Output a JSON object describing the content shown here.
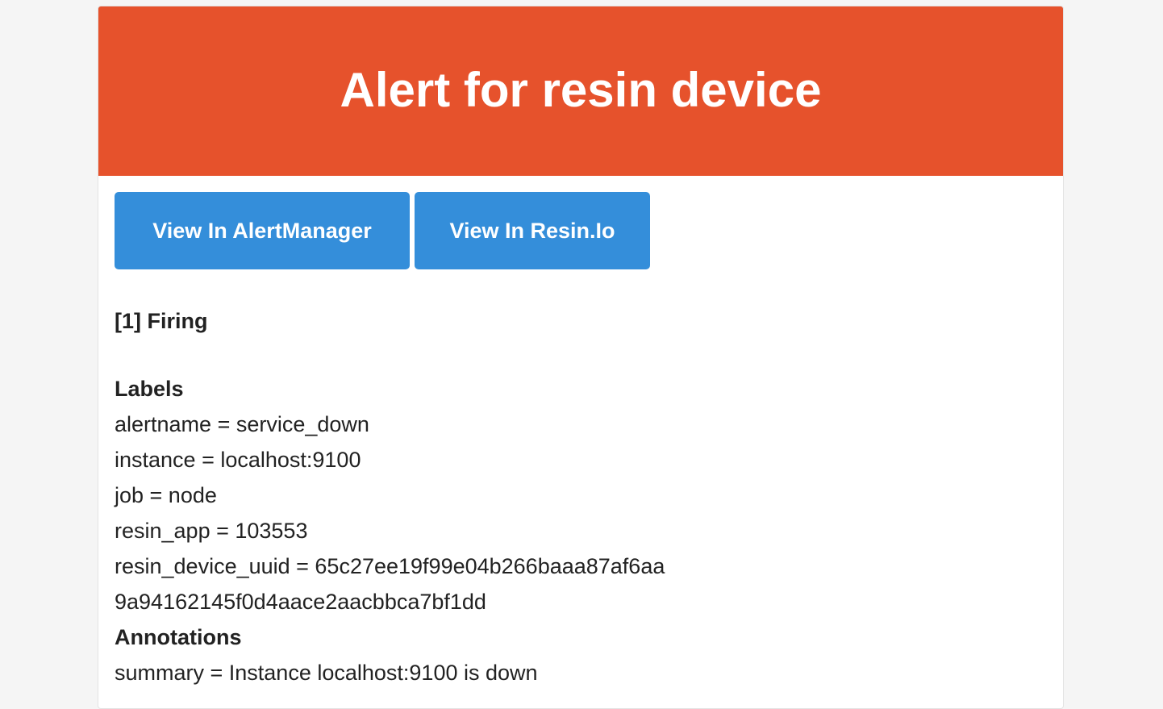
{
  "header": {
    "title": "Alert for resin device",
    "color": "#e6522c"
  },
  "actions": {
    "alertmanager_label": "View In AlertManager",
    "resin_label": "View In Resin.Io",
    "button_color": "#348eda"
  },
  "alert": {
    "status": "[1] Firing",
    "labels_heading": "Labels",
    "labels": [
      "alertname = service_down",
      "instance = localhost:9100",
      "job = node",
      "resin_app = 103553",
      "resin_device_uuid = 65c27ee19f99e04b266baaa87af6aa",
      "9a94162145f0d4aace2aacbbca7bf1dd"
    ],
    "annotations_heading": "Annotations",
    "annotations": [
      "summary = Instance localhost:9100 is down"
    ]
  }
}
